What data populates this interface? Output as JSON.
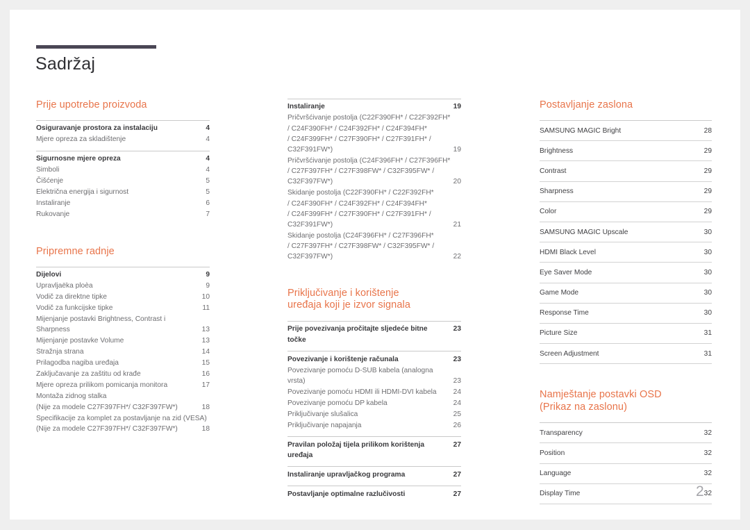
{
  "document": {
    "title": "Sadržaj",
    "page_number": "2",
    "accent_color": "#e8744a",
    "rule_color": "#4a4655"
  },
  "columns": [
    {
      "sections": [
        {
          "heading": "Prije upotrebe proizvoda",
          "groups": [
            {
              "rows": [
                {
                  "label": "Osiguravanje prostora za instalaciju",
                  "page": "4",
                  "head": true
                },
                {
                  "label": "Mjere opreza za skladištenje",
                  "page": "4",
                  "head": false
                }
              ]
            },
            {
              "rows": [
                {
                  "label": "Sigurnosne mjere opreza",
                  "page": "4",
                  "head": true
                },
                {
                  "label": "Simboli",
                  "page": "4",
                  "head": false
                },
                {
                  "label": "Čišćenje",
                  "page": "5",
                  "head": false
                },
                {
                  "label": "Električna energija i sigurnost",
                  "page": "5",
                  "head": false
                },
                {
                  "label": "Instaliranje",
                  "page": "6",
                  "head": false
                },
                {
                  "label": "Rukovanje",
                  "page": "7",
                  "head": false
                }
              ]
            }
          ]
        },
        {
          "heading": "Pripremne radnje",
          "groups": [
            {
              "rows": [
                {
                  "label": "Dijelovi",
                  "page": "9",
                  "head": true
                },
                {
                  "label": "Upravljaëka ploèa",
                  "page": "9",
                  "head": false
                },
                {
                  "label": "Vodič za direktne tipke",
                  "page": "10",
                  "head": false
                },
                {
                  "label": "Vodič za funkcijske tipke",
                  "page": "11",
                  "head": false
                },
                {
                  "label": "Mijenjanje postavki Brightness, Contrast i",
                  "label2": "Sharpness",
                  "page": "13",
                  "head": false,
                  "multi": true
                },
                {
                  "label": "Mijenjanje postavke Volume",
                  "page": "13",
                  "head": false
                },
                {
                  "label": "Stražnja strana",
                  "page": "14",
                  "head": false
                },
                {
                  "label": "Prilagodba nagiba uređaja",
                  "page": "15",
                  "head": false
                },
                {
                  "label": "Zaključavanje za zaštitu od krađe",
                  "page": "16",
                  "head": false
                },
                {
                  "label": "Mjere opreza prilikom pomicanja monitora",
                  "page": "17",
                  "head": false
                },
                {
                  "label": "Montaža zidnog stalka",
                  "label2": "(Nije za modele C27F397FH*/ C32F397FW*)",
                  "page": "18",
                  "head": false,
                  "multi": true
                },
                {
                  "label": "Specifikacije za komplet za postavljanje na zid (VESA)",
                  "label2": "(Nije za modele C27F397FH*/ C32F397FW*)",
                  "page": "18",
                  "head": false,
                  "multi": true
                }
              ]
            }
          ]
        }
      ]
    },
    {
      "sections": [
        {
          "heading": "",
          "groups": [
            {
              "rows": [
                {
                  "label": "Instaliranje",
                  "page": "19",
                  "head": true
                },
                {
                  "label": "Pričvršćivanje postolja (C22F390FH* / C22F392FH*",
                  "label2": "/ C24F390FH* / C24F392FH* / C24F394FH*",
                  "label3": "/ C24F399FH* / C27F390FH* / C27F391FH* /",
                  "label4": "C32F391FW*)",
                  "page": "19",
                  "head": false,
                  "multi": true
                },
                {
                  "label": "Pričvršćivanje postolja (C24F396FH* / C27F396FH*",
                  "label2": "/ C27F397FH* / C27F398FW* / C32F395FW* /",
                  "label3": "C32F397FW*)",
                  "page": "20",
                  "head": false,
                  "multi": true
                },
                {
                  "label": "Skidanje postolja (C22F390FH* / C22F392FH*",
                  "label2": "/ C24F390FH* / C24F392FH* / C24F394FH*",
                  "label3": "/ C24F399FH* / C27F390FH* / C27F391FH* /",
                  "label4": "C32F391FW*)",
                  "page": "21",
                  "head": false,
                  "multi": true
                },
                {
                  "label": "Skidanje postolja (C24F396FH* / C27F396FH*",
                  "label2": "/ C27F397FH* / C27F398FW* / C32F395FW* /",
                  "label3": "C32F397FW*)",
                  "page": "22",
                  "head": false,
                  "multi": true
                }
              ]
            }
          ]
        },
        {
          "heading": "Priključivanje i korištenje\nuređaja koji je izvor signala",
          "heading_line1": "Priključivanje i korištenje",
          "heading_line2": "uređaja koji je izvor signala",
          "groups": [
            {
              "rows": [
                {
                  "label": "Prije povezivanja pročitajte sljedeće bitne točke",
                  "page": "23",
                  "head": true
                }
              ]
            },
            {
              "rows": [
                {
                  "label": "Povezivanje i korištenje računala",
                  "page": "23",
                  "head": true
                },
                {
                  "label": "Povezivanje pomoću D-SUB kabela (analogna",
                  "label2": "vrsta)",
                  "page": "23",
                  "head": false,
                  "multi": true
                },
                {
                  "label": "Povezivanje pomoću HDMI ili HDMI-DVI kabela",
                  "page": "24",
                  "head": false
                },
                {
                  "label": "Povezivanje pomoću DP kabela",
                  "page": "24",
                  "head": false
                },
                {
                  "label": "Priključivanje slušalica",
                  "page": "25",
                  "head": false
                },
                {
                  "label": "Priključivanje napajanja",
                  "page": "26",
                  "head": false
                }
              ]
            },
            {
              "rows": [
                {
                  "label": "Pravilan položaj tijela prilikom korištenja uređaja",
                  "page": "27",
                  "head": true
                }
              ]
            },
            {
              "rows": [
                {
                  "label": "Instaliranje upravljačkog programa",
                  "page": "27",
                  "head": true
                }
              ]
            },
            {
              "rows": [
                {
                  "label": "Postavljanje optimalne razlučivosti",
                  "page": "27",
                  "head": true
                }
              ]
            }
          ]
        }
      ]
    },
    {
      "sections": [
        {
          "heading": "Postavljanje zaslona",
          "ruled": true,
          "rows": [
            {
              "label": "SAMSUNG MAGIC Bright",
              "page": "28"
            },
            {
              "label": "Brightness",
              "page": "29"
            },
            {
              "label": "Contrast",
              "page": "29"
            },
            {
              "label": "Sharpness",
              "page": "29"
            },
            {
              "label": "Color",
              "page": "29"
            },
            {
              "label": "SAMSUNG MAGIC Upscale",
              "page": "30"
            },
            {
              "label": "HDMI Black Level",
              "page": "30"
            },
            {
              "label": "Eye Saver Mode",
              "page": "30"
            },
            {
              "label": "Game Mode",
              "page": "30"
            },
            {
              "label": "Response Time",
              "page": "30"
            },
            {
              "label": "Picture Size",
              "page": "31"
            },
            {
              "label": "Screen Adjustment",
              "page": "31"
            }
          ]
        },
        {
          "heading_line1": "Namještanje postavki OSD",
          "heading_line2": "(Prikaz na zaslonu)",
          "ruled": true,
          "rows": [
            {
              "label": "Transparency",
              "page": "32"
            },
            {
              "label": "Position",
              "page": "32"
            },
            {
              "label": "Language",
              "page": "32"
            },
            {
              "label": "Display Time",
              "page": "32"
            }
          ]
        }
      ]
    }
  ]
}
